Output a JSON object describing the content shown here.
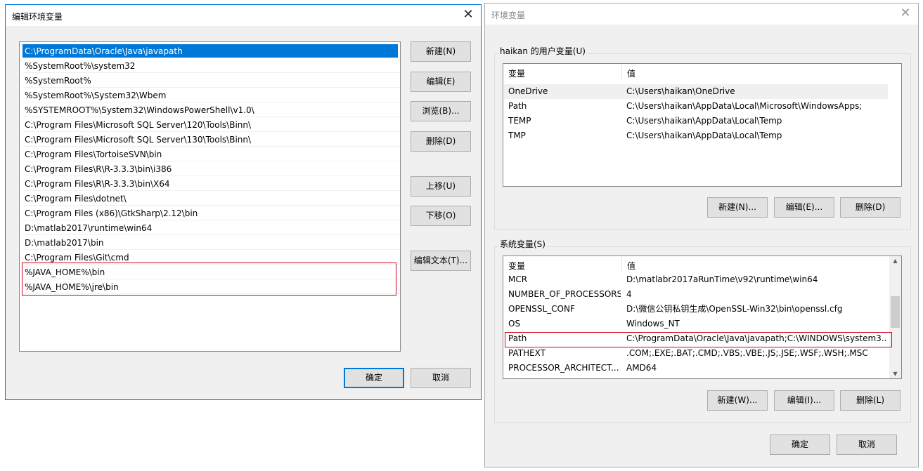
{
  "edit_dialog": {
    "title": "编辑环境变量",
    "paths": [
      "C:\\ProgramData\\Oracle\\Java\\javapath",
      "%SystemRoot%\\system32",
      "%SystemRoot%",
      "%SystemRoot%\\System32\\Wbem",
      "%SYSTEMROOT%\\System32\\WindowsPowerShell\\v1.0\\",
      "C:\\Program Files\\Microsoft SQL Server\\120\\Tools\\Binn\\",
      "C:\\Program Files\\Microsoft SQL Server\\130\\Tools\\Binn\\",
      "C:\\Program Files\\TortoiseSVN\\bin",
      "C:\\Program Files\\R\\R-3.3.3\\bin\\i386",
      "C:\\Program Files\\R\\R-3.3.3\\bin\\X64",
      "C:\\Program Files\\dotnet\\",
      "C:\\Program Files (x86)\\GtkSharp\\2.12\\bin",
      "D:\\matlab2017\\runtime\\win64",
      "D:\\matlab2017\\bin",
      "C:\\Program Files\\Git\\cmd",
      "%JAVA_HOME%\\bin",
      "%JAVA_HOME%\\jre\\bin"
    ],
    "buttons": {
      "new": "新建(N)",
      "edit": "编辑(E)",
      "browse": "浏览(B)...",
      "delete": "删除(D)",
      "move_up": "上移(U)",
      "move_down": "下移(O)",
      "edit_text": "编辑文本(T)...",
      "ok": "确定",
      "cancel": "取消"
    }
  },
  "env_dialog": {
    "title": "环境变量",
    "user_group": "haikan 的用户变量(U)",
    "system_group": "系统变量(S)",
    "col_var": "变量",
    "col_val": "值",
    "user_vars": [
      {
        "name": "OneDrive",
        "value": "C:\\Users\\haikan\\OneDrive"
      },
      {
        "name": "Path",
        "value": "C:\\Users\\haikan\\AppData\\Local\\Microsoft\\WindowsApps;"
      },
      {
        "name": "TEMP",
        "value": "C:\\Users\\haikan\\AppData\\Local\\Temp"
      },
      {
        "name": "TMP",
        "value": "C:\\Users\\haikan\\AppData\\Local\\Temp"
      }
    ],
    "system_vars": [
      {
        "name": "MCR",
        "value": "D:\\matlabr2017aRunTime\\v92\\runtime\\win64"
      },
      {
        "name": "NUMBER_OF_PROCESSORS",
        "value": "4"
      },
      {
        "name": "OPENSSL_CONF",
        "value": "D:\\微信公钥私钥生成\\OpenSSL-Win32\\bin\\openssl.cfg"
      },
      {
        "name": "OS",
        "value": "Windows_NT"
      },
      {
        "name": "Path",
        "value": "C:\\ProgramData\\Oracle\\Java\\javapath;C:\\WINDOWS\\system3..."
      },
      {
        "name": "PATHEXT",
        "value": ".COM;.EXE;.BAT;.CMD;.VBS;.VBE;.JS;.JSE;.WSF;.WSH;.MSC"
      },
      {
        "name": "PROCESSOR_ARCHITECT...",
        "value": "AMD64"
      }
    ],
    "user_buttons": {
      "new": "新建(N)...",
      "edit": "编辑(E)...",
      "delete": "删除(D)"
    },
    "system_buttons": {
      "new": "新建(W)...",
      "edit": "编辑(I)...",
      "delete": "删除(L)"
    },
    "ok": "确定",
    "cancel": "取消"
  },
  "icons": {
    "close": "✕",
    "scroll_up": "▲",
    "scroll_down": "▼"
  },
  "colors": {
    "selection": "#0078d7",
    "highlight_border": "#d0021b",
    "dialog_bg": "#f0f0f0"
  }
}
